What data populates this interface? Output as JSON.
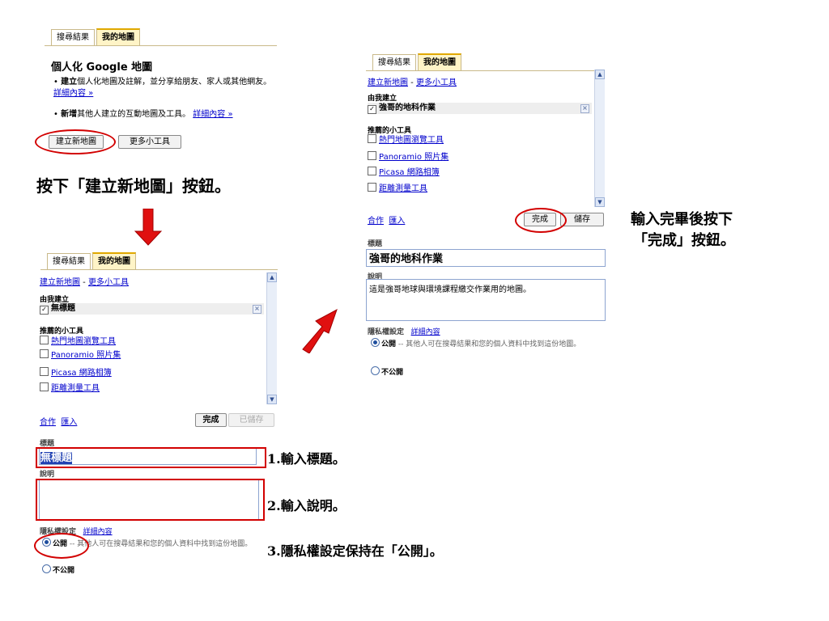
{
  "tabs": {
    "search": "搜尋結果",
    "mymaps": "我的地圖"
  },
  "panel1": {
    "heading": "個人化 Google 地圖",
    "bullet1": {
      "bold": "建立",
      "text": "個人化地圖及註解，並分享給朋友、家人或其他網友。",
      "link": "詳細內容 »"
    },
    "bullet2": {
      "bold": "新增",
      "text": "其他人建立的互動地圖及工具。",
      "link": "詳細內容 »"
    },
    "create_button": "建立新地圖",
    "more_button": "更多小工具"
  },
  "caption_create": "按下「建立新地圖」按鈕。",
  "links": {
    "create": "建立新地圖",
    "sep": " - ",
    "more": "更多小工具"
  },
  "lists": {
    "created_by_me": "由我建立",
    "recommended": "推薦的小工具",
    "tools": [
      "熱門地圖瀏覽工具",
      "Panoramio 照片集",
      "Picasa 網路相簿",
      "距離測量工具"
    ]
  },
  "panel2": {
    "map_item": "無標題",
    "collab": "合作",
    "import": "匯入",
    "done": "完成",
    "saved": "已儲存",
    "title_label": "標題",
    "title_value": "無標題",
    "desc_label": "說明",
    "desc_value": "",
    "privacy_label": "隱私權設定",
    "privacy_link": "詳細內容",
    "public": "公開",
    "public_desc": "-- 其他人可在搜尋結果和您的個人資料中找到這份地圖。",
    "private": "不公開"
  },
  "panel3": {
    "map_item": "強哥的地科作業",
    "collab": "合作",
    "import": "匯入",
    "done": "完成",
    "save": "儲存",
    "title_label": "標題",
    "title_value": "強哥的地科作業",
    "desc_label": "說明",
    "desc_value": "這是強哥地球與環境課程繳交作業用的地圖。",
    "privacy_label": "隱私權設定",
    "privacy_link": "詳細內容",
    "public": "公開",
    "public_desc": "-- 其他人可在搜尋結果和您的個人資料中找到這份地圖。",
    "private": "不公開"
  },
  "steps": {
    "step1": "1.輸入標題。",
    "step2": "2.輸入說明。",
    "step3": "3.隱私權設定保持在「公開」。"
  },
  "caption_done_line1": "輸入完畢後按下",
  "caption_done_line2": "「完成」按鈕。",
  "colors": {
    "highlight": "#d20000",
    "link": "#0000cc",
    "tab_active": "#fff4c7"
  }
}
